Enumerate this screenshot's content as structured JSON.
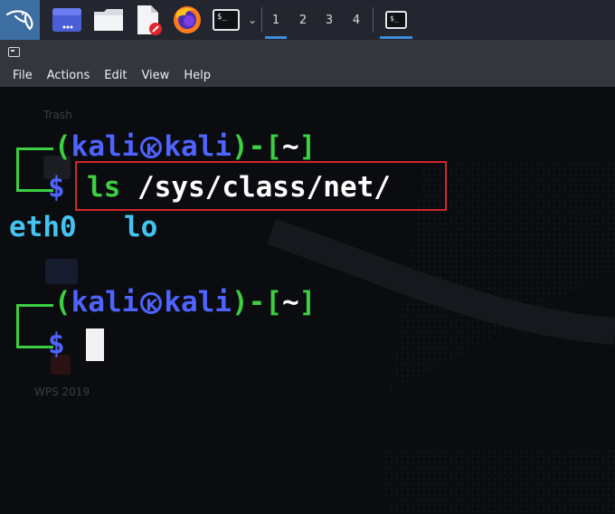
{
  "panel": {
    "app_launchers": [
      {
        "name": "kali-menu-icon"
      },
      {
        "name": "show-desktop-icon"
      },
      {
        "name": "file-manager-icon"
      },
      {
        "name": "text-editor-icon"
      },
      {
        "name": "firefox-icon"
      },
      {
        "name": "terminal-launcher-icon",
        "glyph": "$_"
      }
    ],
    "workspaces": [
      "1",
      "2",
      "3",
      "4"
    ],
    "active_workspace": "1",
    "task_glyph": "$_"
  },
  "window": {
    "menu": [
      "File",
      "Actions",
      "Edit",
      "View",
      "Help"
    ]
  },
  "desktop_ghost": {
    "trash": "Trash",
    "wps": "WPS 2019"
  },
  "terminal": {
    "prompt1": {
      "open": "(",
      "user": "kali",
      "host": "kali",
      "close": ")-[",
      "dir": "~",
      "end": "]",
      "symbol": "$",
      "command": "ls",
      "argument": "/sys/class/net/"
    },
    "output": [
      "eth0",
      "lo"
    ],
    "prompt2": {
      "open": "(",
      "user": "kali",
      "host": "kali",
      "close": ")-[",
      "dir": "~",
      "end": "]",
      "symbol": "$"
    }
  },
  "colors": {
    "prompt_green": "#3ccf41",
    "user_blue": "#4f63ff",
    "output_cyan": "#45c3f0",
    "highlight_red": "#d3252b",
    "panel": "#23262e",
    "accent": "#3c8cdb"
  }
}
